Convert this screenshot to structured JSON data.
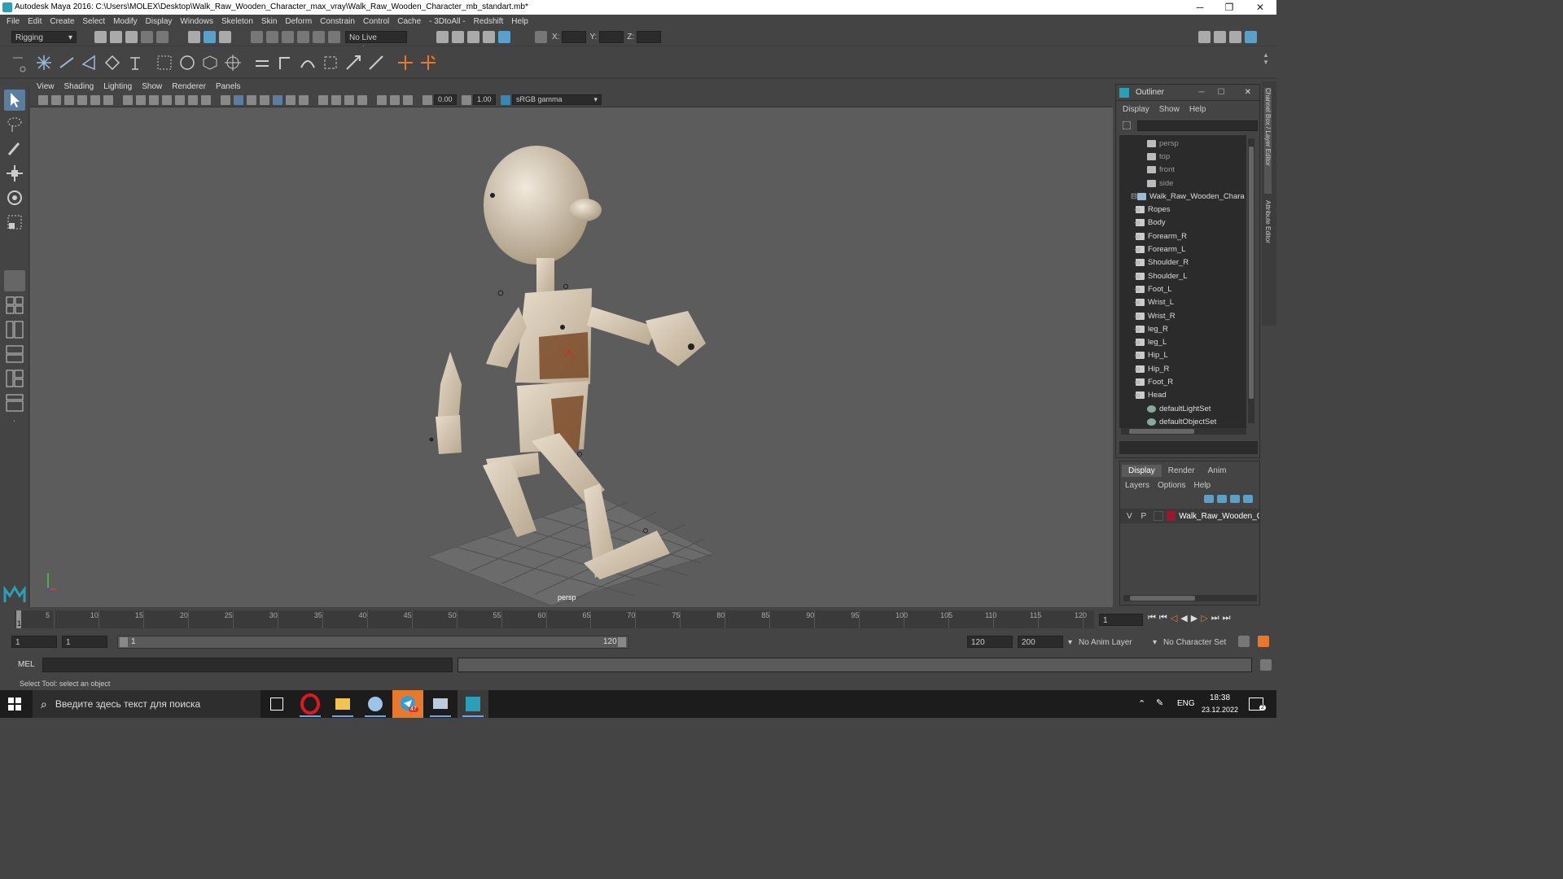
{
  "window": {
    "title": "Autodesk Maya 2016: C:\\Users\\MOLEX\\Desktop\\Walk_Raw_Wooden_Character_max_vray\\Walk_Raw_Wooden_Character_mb_standart.mb*",
    "minimize": "─",
    "maximize": "❐",
    "close": "✕"
  },
  "menu": [
    "File",
    "Edit",
    "Create",
    "Select",
    "Modify",
    "Display",
    "Windows",
    "Skeleton",
    "Skin",
    "Deform",
    "Constrain",
    "Control",
    "Cache",
    "- 3DtoAll -",
    "Redshift",
    "Help"
  ],
  "status": {
    "mode": "Rigging",
    "live_surface": "No Live Surface",
    "x_label": "X:",
    "y_label": "Y:",
    "z_label": "Z:"
  },
  "viewport": {
    "menu": [
      "View",
      "Shading",
      "Lighting",
      "Show",
      "Renderer",
      "Panels"
    ],
    "exposure": "0.00",
    "gamma": "1.00",
    "color_space": "sRGB gamma",
    "camera_label": "persp"
  },
  "outliner": {
    "title": "Outliner",
    "menu": [
      "Display",
      "Show",
      "Help"
    ],
    "items": [
      {
        "label": "persp",
        "type": "camera",
        "indent": 1,
        "dim": true
      },
      {
        "label": "top",
        "type": "camera",
        "indent": 1,
        "dim": true
      },
      {
        "label": "front",
        "type": "camera",
        "indent": 1,
        "dim": true
      },
      {
        "label": "side",
        "type": "camera",
        "indent": 1,
        "dim": true
      },
      {
        "label": "Walk_Raw_Wooden_Chara",
        "type": "group",
        "indent": 0,
        "dim": false
      },
      {
        "label": "Ropes",
        "type": "mesh",
        "indent": 2,
        "dim": false
      },
      {
        "label": "Body",
        "type": "mesh",
        "indent": 2,
        "dim": false
      },
      {
        "label": "Forearm_R",
        "type": "mesh",
        "indent": 2,
        "dim": false
      },
      {
        "label": "Forearm_L",
        "type": "mesh",
        "indent": 2,
        "dim": false
      },
      {
        "label": "Shoulder_R",
        "type": "mesh",
        "indent": 2,
        "dim": false
      },
      {
        "label": "Shoulder_L",
        "type": "mesh",
        "indent": 2,
        "dim": false
      },
      {
        "label": "Foot_L",
        "type": "mesh",
        "indent": 2,
        "dim": false
      },
      {
        "label": "Wrist_L",
        "type": "mesh",
        "indent": 2,
        "dim": false
      },
      {
        "label": "Wrist_R",
        "type": "mesh",
        "indent": 2,
        "dim": false
      },
      {
        "label": "leg_R",
        "type": "mesh",
        "indent": 2,
        "dim": false
      },
      {
        "label": "leg_L",
        "type": "mesh",
        "indent": 2,
        "dim": false
      },
      {
        "label": "Hip_L",
        "type": "mesh",
        "indent": 2,
        "dim": false
      },
      {
        "label": "Hip_R",
        "type": "mesh",
        "indent": 2,
        "dim": false
      },
      {
        "label": "Foot_R",
        "type": "mesh",
        "indent": 2,
        "dim": false
      },
      {
        "label": "Head",
        "type": "mesh",
        "indent": 2,
        "dim": false
      },
      {
        "label": "defaultLightSet",
        "type": "set",
        "indent": 1,
        "dim": false
      },
      {
        "label": "defaultObjectSet",
        "type": "set",
        "indent": 1,
        "dim": false
      }
    ]
  },
  "layers": {
    "tabs": [
      "Display",
      "Render",
      "Anim"
    ],
    "menu": [
      "Layers",
      "Options",
      "Help"
    ],
    "row": {
      "v": "V",
      "p": "P",
      "name": "Walk_Raw_Wooden_C",
      "color": "#a0152e"
    }
  },
  "timeline": {
    "ticks": [
      "1",
      "5",
      "10",
      "15",
      "20",
      "25",
      "30",
      "35",
      "40",
      "45",
      "50",
      "55",
      "60",
      "65",
      "70",
      "75",
      "80",
      "85",
      "90",
      "95",
      "100",
      "105",
      "110",
      "115",
      "120"
    ],
    "current": "1"
  },
  "range": {
    "start": "1",
    "playback_start": "1",
    "slider_start": "1",
    "slider_end": "120",
    "playback_end": "120",
    "end": "200",
    "anim_layer": "No Anim Layer",
    "char_set": "No Character Set"
  },
  "command": {
    "label": "MEL"
  },
  "help": {
    "text": "Select Tool: select an object"
  },
  "side_tabs": [
    "Channel Box / Layer Editor",
    "Attribute Editor"
  ],
  "taskbar": {
    "search": "Введите здесь текст для поиска",
    "lang": "ENG",
    "time": "18:38",
    "date": "23.12.2022",
    "telegram_badge": "47",
    "notification": "2"
  }
}
